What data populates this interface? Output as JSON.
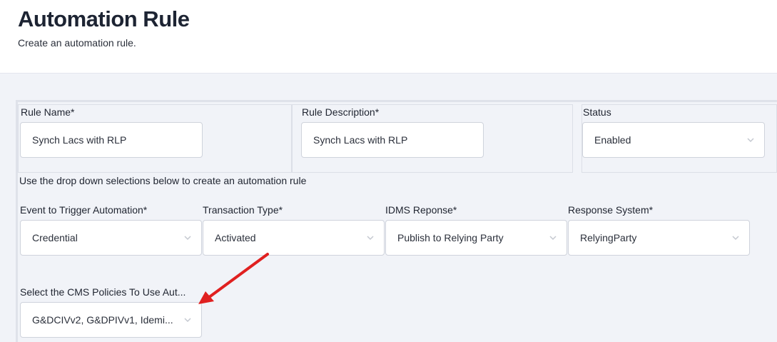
{
  "header": {
    "title": "Automation Rule",
    "subtitle": "Create an automation rule."
  },
  "rule_name": {
    "label": "Rule Name*",
    "value": "Synch Lacs with RLP"
  },
  "rule_description": {
    "label": "Rule Description*",
    "value": "Synch Lacs with RLP"
  },
  "status": {
    "label": "Status",
    "value": "Enabled"
  },
  "instruction": "Use the drop down selections below to create an automation rule",
  "event": {
    "label": "Event to Trigger Automation*",
    "value": "Credential"
  },
  "transaction_type": {
    "label": "Transaction Type*",
    "value": "Activated"
  },
  "idms_response": {
    "label": "IDMS Reponse*",
    "value": "Publish to Relying Party"
  },
  "response_system": {
    "label": "Response System*",
    "value": "RelyingParty"
  },
  "cms_policies": {
    "label": "Select the CMS Policies To Use Aut...",
    "value": "G&DCIVv2, G&DPIVv1, Idemi..."
  },
  "colors": {
    "annotation_arrow": "#e02020",
    "chevron": "#c4c8d0"
  },
  "icons": {
    "dropdown": "chevron-down-icon",
    "annotation": "red-arrow-icon"
  }
}
